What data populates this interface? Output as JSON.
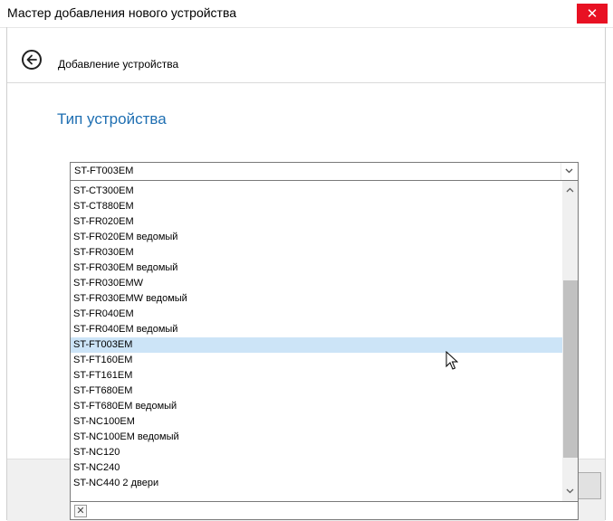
{
  "window": {
    "title": "Мастер добавления нового устройства",
    "close_glyph": "✕"
  },
  "nav": {
    "back_icon": "arrow-left-circle-icon",
    "label": "Добавление устройства"
  },
  "page": {
    "heading": "Тип устройства"
  },
  "device_type": {
    "selected": "ST-FT003EM",
    "options": [
      "ST-CT300EM",
      "ST-CT880EM",
      "ST-FR020EM",
      "ST-FR020EM ведомый",
      "ST-FR030EM",
      "ST-FR030EM ведомый",
      "ST-FR030EMW",
      "ST-FR030EMW ведомый",
      "ST-FR040EM",
      "ST-FR040EM ведомый",
      "ST-FT003EM",
      "ST-FT160EM",
      "ST-FT161EM",
      "ST-FT680EM",
      "ST-FT680EM ведомый",
      "ST-NC100EM",
      "ST-NC100EM ведомый",
      "ST-NC120",
      "ST-NC240",
      "ST-NC440 2 двери"
    ],
    "highlighted_index": 10,
    "clear_glyph": "✕"
  },
  "colors": {
    "accent": "#1f6fb2",
    "selection": "#cce4f7",
    "close": "#e81123"
  }
}
